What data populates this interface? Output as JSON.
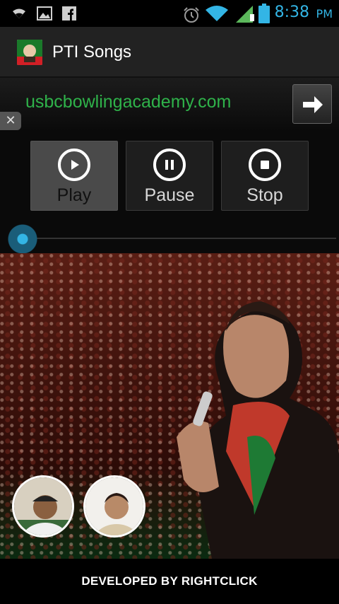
{
  "status_bar": {
    "time": "8:38",
    "ampm": "PM",
    "accent_color": "#33b5e5",
    "icons": [
      "wifi-signal-icon",
      "image-icon",
      "facebook-icon",
      "alarm-icon",
      "wifi-icon",
      "cell-signal-icon",
      "battery-icon"
    ]
  },
  "app": {
    "title": "PTI Songs",
    "logo_icon": "pti-logo-icon"
  },
  "ad": {
    "text": "usbcbowlingacademy.com",
    "text_color": "#2fb24a",
    "arrow_icon": "arrow-right-icon",
    "close_label": "✕"
  },
  "controls": {
    "play_label": "Play",
    "pause_label": "Pause",
    "stop_label": "Stop",
    "active": "play"
  },
  "seek": {
    "progress": 0.0
  },
  "footer": {
    "text": "DEVELOPED BY RIGHTCLICK"
  }
}
